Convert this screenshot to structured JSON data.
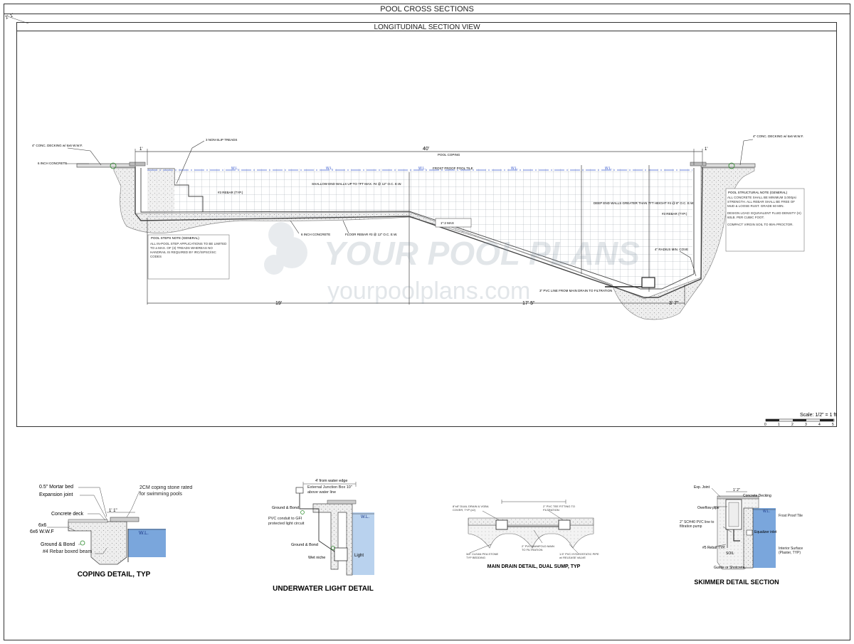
{
  "sheet": {
    "title": "POOL CROSS SECTIONS",
    "corner_mark": "1' 1'"
  },
  "section": {
    "title": "LONGITUDINAL SECTION VIEW",
    "dims": {
      "overall": "40'",
      "left_deck": "1'",
      "right_deck": "1'",
      "shallow_len": "19'",
      "slope_len": "17' 5\"",
      "deep_len": "3' 7\""
    },
    "wl_marks": [
      "W.L.",
      "W.L.",
      "W.L.",
      "W.L.",
      "W.L."
    ],
    "labels": {
      "conc_decking_left": "4\" CONC. DECKING w/ 6x6 W.W.F.",
      "six_inch_concrete_left": "6 INCH CONCRETE",
      "non_slip_treads": "3 NON-SLIP TREADS",
      "pool_coping": "POOL COPING",
      "frost_proof_tile": "FROST PROOF POOL TILE",
      "conc_decking_right": "4\" CONC. DECKING w/ 6x6 W.W.F.",
      "rebar_left": "#3 REBAR (TYP.)",
      "shallow_walls": "SHALLOW END WALLS UP TO 7FT MAX. #4 @ 12\" O.C. E.W.",
      "deep_walls": "DEEP END WALLS GREATER THAN 7FT HEIGHT #4 @ 8\" O.C. E.W.",
      "rebar_right": "#3 REBAR (TYP.)",
      "six_inch_concrete_floor": "6 INCH CONCRETE",
      "floor_rebar": "FLOOR REBAR #3 @ 12\" O.C. E.W.",
      "slope_max": "1\":2 MAX",
      "radius_cove": "4\" RADIUS MIN. COVE",
      "pvc_main_drain": "3\" PVC LINE FROM MAIN DRAIN TO FILTRATION"
    },
    "steps_note": {
      "title": "POOL STEPS NOTE (GENERAL)",
      "body": "ALL IN-POOL STEP APPLICATIONS TO BE LIMITED TO a MAX. OF (3) TREADS WHEREAS NO HANDRAIL IS REQUIRED BY IRC/ISPSC/ISC CODES"
    },
    "structural_note": {
      "title": "POOL STRUCTURAL NOTE (GENERAL)",
      "line1": "ALL CONCRETE SHALL BE MINIMUM 3,000psi STRENGTH. ALL REBAR SHALL BE FREE OF MUD & LOOSE RUST. GRADE 60 MIN.",
      "line2": "DESIGN LOAD: EQUIVALENT FLUID DENSITY (H) 60LB. PER CUBIC FOOT.",
      "line3": "COMPACT VIRGIN SOIL TO 95% PROCTOR."
    },
    "watermark": {
      "brand": "YOUR POOL PLANS",
      "url": "yourpoolplans.com"
    },
    "scale": {
      "label": "Scale: 1/2\" = 1 ft",
      "ticks": [
        "0",
        "1",
        "2",
        "3",
        "4",
        "5"
      ]
    }
  },
  "details": {
    "coping": {
      "title": "COPING DETAIL, TYP",
      "labels": {
        "mortar_bed": "0.5\" Mortar bed",
        "expansion_joint": "Expansion joint",
        "coping_stone": "2CM coping stone rated for swimming pools",
        "concrete_deck": "Concrete deck",
        "dim": "1' 1\"",
        "wwf": "6x6 W.W.F",
        "wl": "W.L.",
        "ground_bond": "Ground & Bond",
        "rebar_beam": "#4 Rebar boxed beam"
      }
    },
    "light": {
      "title": "UNDERWATER LIGHT DETAIL",
      "labels": {
        "from_edge": "4' from water edge",
        "junction_box": "External Junction Box 10\" above water line",
        "ground_bond_top": "Ground & Bond",
        "pvc_conduit": "PVC conduit to GFI protected light circuit",
        "ground_bond_low": "Ground & Bond",
        "wet_niche": "Wet niche",
        "light": "Light",
        "wl": "W.L."
      }
    },
    "drain": {
      "title": "MAIN DRAIN DETAIL, DUAL SUMP, TYP",
      "labels": {
        "grates": "8\"x8\" DUAL DRAIN & VGBA COVER, TYP (x2)",
        "tee": "2\" PVC TEE FITTING TO FILTRATION",
        "manifold": "2\" PVC MANIFOLD MAIN TO FILTRATION",
        "pea_stone": "3/8\" CLEAN PEA STONE TYP BEDDING",
        "hydrostatic": "1.5\" PVC HYDROSTATIC PIPE w/ RELEASE VALVE"
      }
    },
    "skimmer": {
      "title": "SKIMMER DETAIL SECTION",
      "labels": {
        "exp_joint": "Exp. Joint",
        "dim": "1' 2\"",
        "concrete_decking": "Concrete Decking",
        "overflow": "Overflow pipe",
        "pvc_line": "2\" SCH40 PVC line to filtration pump",
        "rebar": "#5 Rebar TYP.",
        "soil": "SOIL",
        "gunite": "Gunite or Shotcrete",
        "wl": "W.L.",
        "tile": "Frost Proof Tile",
        "equalizer": "Equalizer inlet",
        "interior": "Interior Surface (Plaster, TYP)"
      }
    }
  }
}
